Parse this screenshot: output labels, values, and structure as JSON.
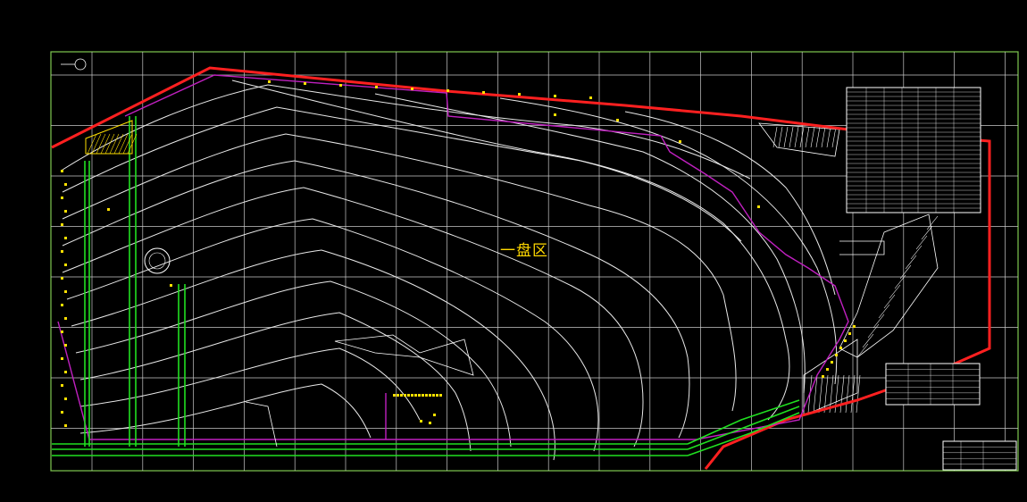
{
  "drawing": {
    "region_label": "一盘区"
  },
  "colors": {
    "background": "#000000",
    "frame": "#7ec850",
    "grid": "#c8c8c8",
    "contour": "#e8e8e8",
    "boundary": "#ff2020",
    "mining_limit": "#c020c0",
    "roadway": "#20e020",
    "marker": "#ffe000",
    "table": "#ffffff"
  },
  "icons": {
    "north_arrow": "north-arrow-icon",
    "borehole": "borehole-icon"
  }
}
